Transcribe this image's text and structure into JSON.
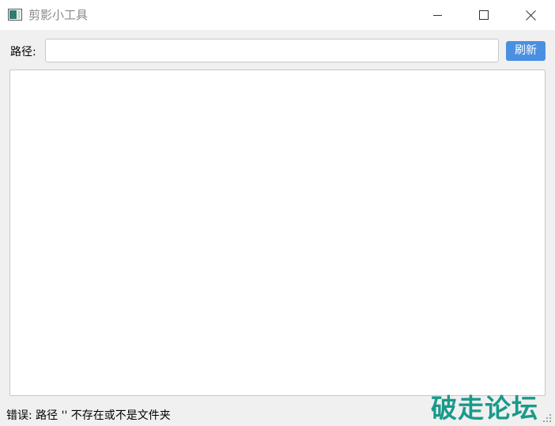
{
  "window": {
    "title": "剪影小工具",
    "icon": "app-window-icon",
    "controls": {
      "minimize_icon": "minimize-icon",
      "maximize_icon": "maximize-icon",
      "close_icon": "close-icon"
    }
  },
  "path_row": {
    "label": "路径:",
    "input_value": "",
    "input_placeholder": "",
    "refresh_label": "刷新"
  },
  "status": {
    "message": "错误: 路径 '' 不存在或不是文件夹"
  },
  "watermark": {
    "text": "破走论坛"
  },
  "colors": {
    "accent": "#4a90e2",
    "watermark": "#1a9a8a",
    "background": "#f0f0f0"
  }
}
